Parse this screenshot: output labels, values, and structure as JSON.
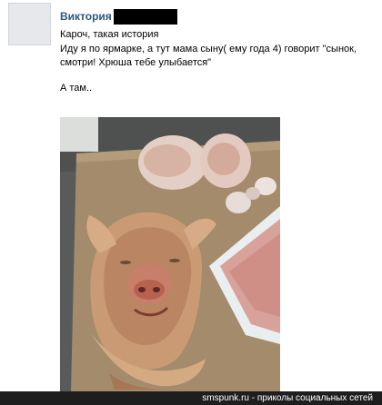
{
  "post": {
    "author_name": "Виктория",
    "lines": [
      "Кароч, такая история",
      "Иду я по ярмарке, а тут мама сыну( ему года 4) говорит \"сынок, смотри! Хрюша тебе улыбается\""
    ],
    "punchline": "А там.."
  },
  "photo": {
    "icon": "pig-head-photo"
  },
  "footer": {
    "watermark": "smspunk.ru - приколы социальных сетей"
  },
  "colors": {
    "author_link": "#2b587a",
    "footer_bg": "#1e1e1e"
  }
}
